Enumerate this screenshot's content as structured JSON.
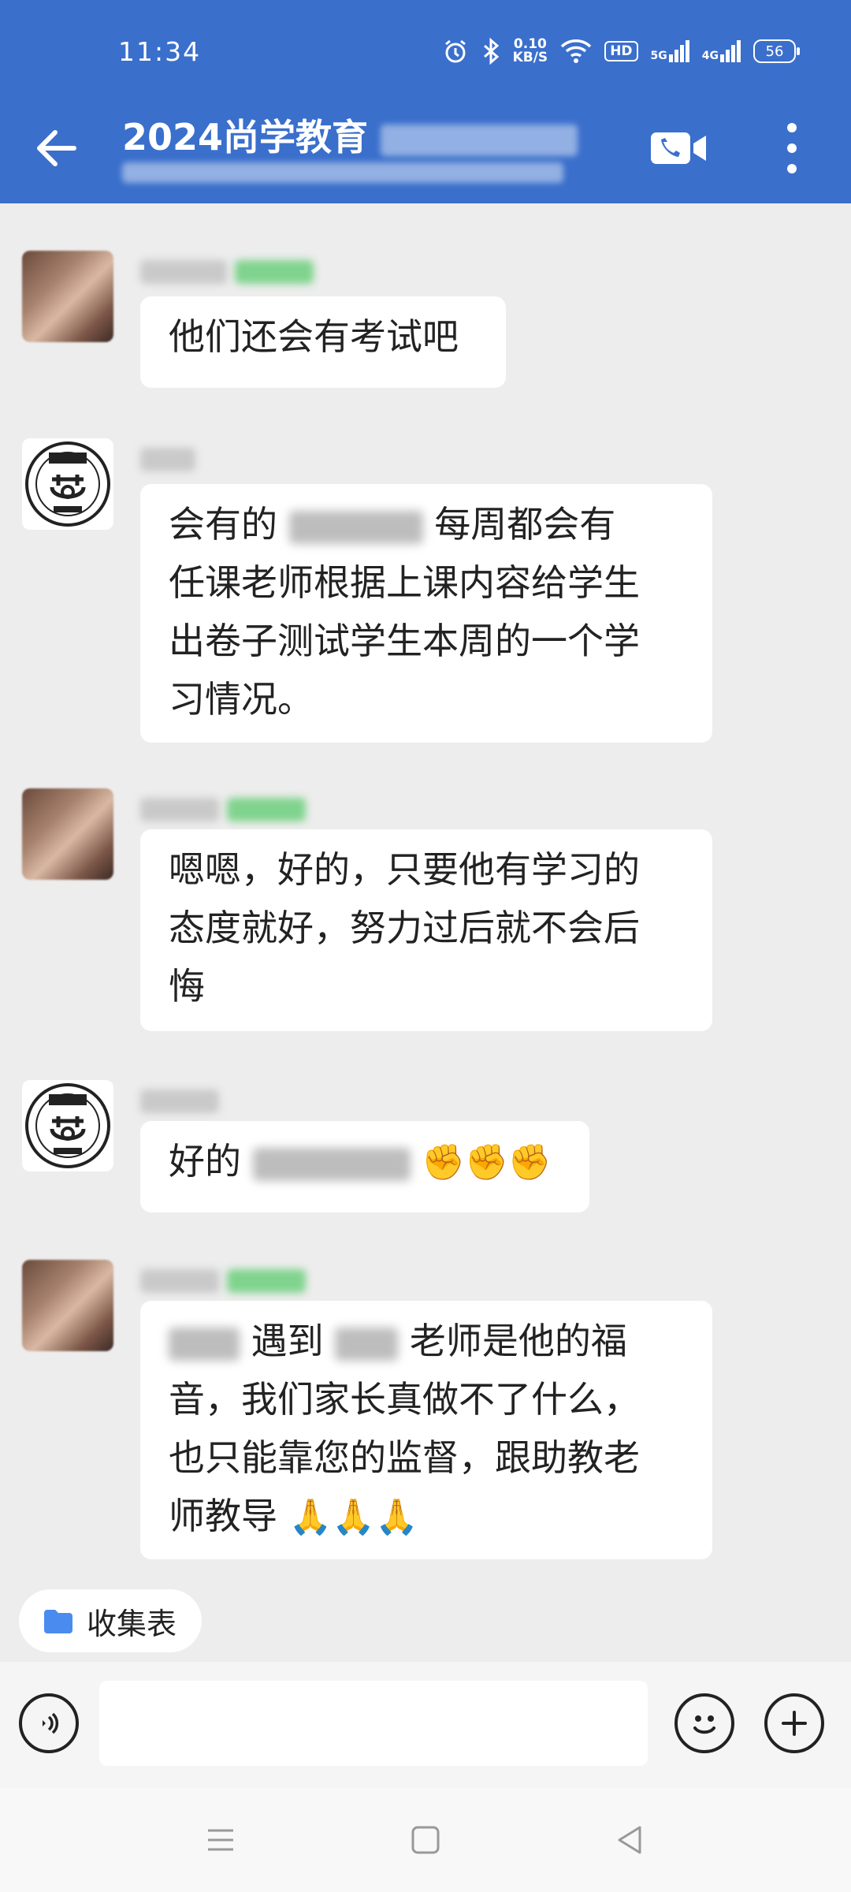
{
  "status_bar": {
    "time": "11:34",
    "net_speed_value": "0.10",
    "net_speed_unit": "KB/S",
    "hd_label": "HD",
    "signal1_label": "5G",
    "signal2_label": "4G",
    "battery": "56"
  },
  "header": {
    "title": "2024尚学教育"
  },
  "messages": [
    {
      "side": "left",
      "avatar": "person",
      "text": "他们还会有考试吧"
    },
    {
      "side": "left",
      "avatar": "logo",
      "lines": [
        "会有的",
        "每周都会有",
        "任课老师根据上课内容给学生",
        "出卷子测试学生本周的一个学",
        "习情况。"
      ]
    },
    {
      "side": "left",
      "avatar": "person",
      "lines": [
        "嗯嗯，好的，只要他有学习的",
        "态度就好，努力过后就不会后",
        "悔"
      ]
    },
    {
      "side": "left",
      "avatar": "logo",
      "text": "好的",
      "emoji": "✊✊✊"
    },
    {
      "side": "left",
      "avatar": "person",
      "lines": [
        "遇到",
        "老师是他的福",
        "音，我们家长真做不了什么，",
        "也只能靠您的监督，跟助教老",
        "师教导"
      ],
      "emoji": "🙏🙏🙏"
    }
  ],
  "quick_chip": {
    "label": "收集表"
  },
  "colors": {
    "header": "#3a6fcc",
    "chat_bg": "#ededed",
    "bubble": "#ffffff"
  }
}
